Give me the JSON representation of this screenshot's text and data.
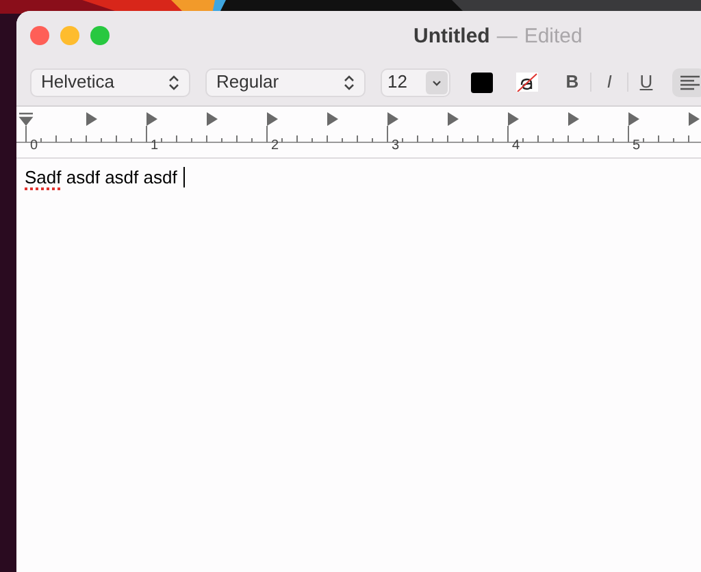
{
  "window": {
    "title": "Untitled",
    "separator": "—",
    "status": "Edited"
  },
  "toolbar": {
    "font": "Helvetica",
    "style": "Regular",
    "size": "12",
    "buttons": [
      {
        "label": "B",
        "kind": "bold"
      },
      {
        "label": "I",
        "kind": "italic"
      },
      {
        "label": "U",
        "kind": "underline"
      }
    ]
  },
  "ruler": {
    "labels": [
      "0",
      "1",
      "2",
      "3",
      "4",
      "5"
    ]
  },
  "document": {
    "words": [
      {
        "text": "Sadf",
        "misspelled": true
      },
      {
        "text": "asdf",
        "misspelled": false
      },
      {
        "text": "asdf",
        "misspelled": false
      },
      {
        "text": "asdf",
        "misspelled": false
      }
    ]
  }
}
